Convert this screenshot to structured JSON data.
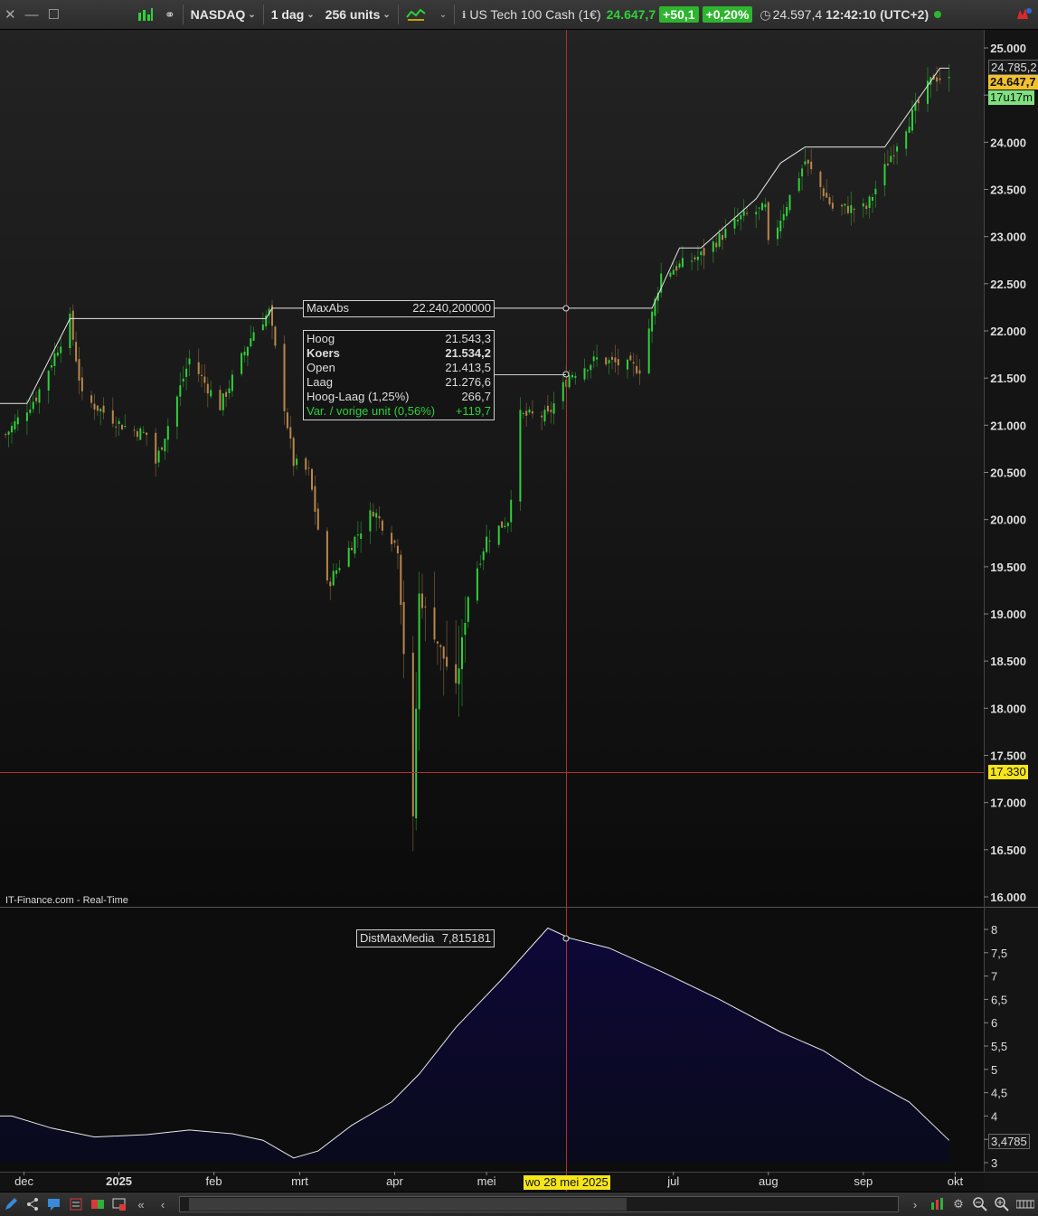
{
  "toolbar": {
    "market": "NASDAQ",
    "timeframe": "1 dag",
    "units": "256 units",
    "instrument": "US Tech 100 Cash (1€)",
    "price": "24.647,7",
    "change": "+50,1",
    "change_pct": "+0,20%",
    "prev_value": "24.597,4",
    "time": "12:42:10 (UTC+2)"
  },
  "legend_top": {
    "koers": "Koers",
    "maxabs": "MaxAbs"
  },
  "legend_bottom": {
    "label": "DistMaxMedia"
  },
  "source_label": "IT-Finance.com - Real-Time",
  "crosshair": {
    "price_tag": "17.330",
    "date_tag": "wo 28 mei 2025"
  },
  "price_tags": {
    "max": "24.785,2",
    "last": "24.647,7",
    "countdown": "17u17m"
  },
  "maxabs_tag": {
    "name": "MaxAbs",
    "value": "22.240,200000"
  },
  "dist_tag": {
    "name": "DistMaxMedia",
    "value": "7,815181",
    "last": "3,4785"
  },
  "tooltip": [
    {
      "label": "Hoog",
      "value": "21.543,3",
      "style": "normal"
    },
    {
      "label": "Koers",
      "value": "21.534,2",
      "style": "bold"
    },
    {
      "label": "Open",
      "value": "21.413,5",
      "style": "normal"
    },
    {
      "label": "Laag",
      "value": "21.276,6",
      "style": "normal"
    },
    {
      "label": "Hoog-Laag (1,25%)",
      "value": "266,7",
      "style": "normal"
    },
    {
      "label": "Var. / vorige unit (0,56%)",
      "value": "+119,7",
      "style": "green"
    }
  ],
  "colors": {
    "up": "#2fd03a",
    "down": "#b8864a",
    "line": "#e8e8e8",
    "crosshair": "#b03030",
    "area": "#0c0a2e"
  },
  "chart_data": [
    {
      "type": "candlestick",
      "title": "US Tech 100 Cash (1€)",
      "xlabel": "",
      "ylabel": "",
      "x_ticks": [
        "dec",
        "2025",
        "feb",
        "mrt",
        "apr",
        "mei",
        "jul",
        "aug",
        "sep",
        "okt"
      ],
      "y_ticks": [
        "25.000",
        "24.500",
        "24.000",
        "23.500",
        "23.000",
        "22.500",
        "22.000",
        "21.500",
        "21.000",
        "20.500",
        "20.000",
        "19.500",
        "19.000",
        "18.500",
        "18.000",
        "17.500",
        "17.000",
        "16.500",
        "16.000"
      ],
      "ylim": [
        16000,
        25000
      ],
      "x_range": [
        "2024-11-27",
        "2025-10-05"
      ],
      "series": [
        {
          "name": "Koers",
          "style": "ohlc-bars",
          "path": [
            [
              "2024-11-25",
              20900
            ],
            [
              "2024-12-05",
              21300
            ],
            [
              "2024-12-16",
              22120
            ],
            [
              "2024-12-20",
              21300
            ],
            [
              "2025-01-02",
              21000
            ],
            [
              "2025-01-10",
              20900
            ],
            [
              "2025-01-13",
              20600
            ],
            [
              "2025-01-24",
              21700
            ],
            [
              "2025-02-03",
              21200
            ],
            [
              "2025-02-14",
              22000
            ],
            [
              "2025-02-19",
              22200
            ],
            [
              "2025-02-27",
              20600
            ],
            [
              "2025-03-04",
              20500
            ],
            [
              "2025-03-10",
              19300
            ],
            [
              "2025-03-19",
              19800
            ],
            [
              "2025-03-25",
              20100
            ],
            [
              "2025-04-02",
              19700
            ],
            [
              "2025-04-04",
              18600
            ],
            [
              "2025-04-07",
              16800
            ],
            [
              "2025-04-09",
              19200
            ],
            [
              "2025-04-21",
              18200
            ],
            [
              "2025-04-25",
              19200
            ],
            [
              "2025-05-01",
              19800
            ],
            [
              "2025-05-08",
              20000
            ],
            [
              "2025-05-12",
              21100
            ],
            [
              "2025-05-21",
              21100
            ],
            [
              "2025-05-28",
              21534
            ],
            [
              "2025-06-06",
              21700
            ],
            [
              "2025-06-20",
              21600
            ],
            [
              "2025-06-27",
              22600
            ],
            [
              "2025-07-10",
              22800
            ],
            [
              "2025-07-23",
              23200
            ],
            [
              "2025-07-31",
              23300
            ],
            [
              "2025-08-01",
              22900
            ],
            [
              "2025-08-13",
              23800
            ],
            [
              "2025-08-22",
              23300
            ],
            [
              "2025-09-02",
              23300
            ],
            [
              "2025-09-12",
              24000
            ],
            [
              "2025-09-24",
              24700
            ],
            [
              "2025-09-29",
              24647.7
            ]
          ]
        },
        {
          "name": "MaxAbs",
          "style": "step-line",
          "steps": [
            [
              "2024-11-27",
              21230
            ],
            [
              "2024-12-02",
              21230
            ],
            [
              "2024-12-16",
              22130
            ],
            [
              "2025-02-18",
              22130
            ],
            [
              "2025-02-20",
              22240.2
            ],
            [
              "2025-06-24",
              22240.2
            ],
            [
              "2025-07-03",
              22880
            ],
            [
              "2025-07-10",
              22880
            ],
            [
              "2025-07-28",
              23400
            ],
            [
              "2025-08-05",
              23780
            ],
            [
              "2025-08-13",
              23950
            ],
            [
              "2025-09-08",
              23950
            ],
            [
              "2025-09-26",
              24785.2
            ],
            [
              "2025-09-29",
              24785.2
            ]
          ]
        }
      ]
    },
    {
      "type": "area",
      "title": "DistMaxMedia",
      "xlabel": "",
      "ylabel": "",
      "y_ticks": [
        "8",
        "7,5",
        "7",
        "6,5",
        "6",
        "5,5",
        "5",
        "4,5",
        "4",
        "3,5",
        "3"
      ],
      "ylim": [
        3,
        8
      ],
      "series": [
        {
          "name": "DistMaxMedia",
          "points": [
            [
              "2024-11-27",
              4.0
            ],
            [
              "2024-12-10",
              3.74
            ],
            [
              "2024-12-24",
              3.55
            ],
            [
              "2025-01-10",
              3.6
            ],
            [
              "2025-01-24",
              3.7
            ],
            [
              "2025-02-07",
              3.62
            ],
            [
              "2025-02-17",
              3.48
            ],
            [
              "2025-02-27",
              3.1
            ],
            [
              "2025-03-07",
              3.25
            ],
            [
              "2025-03-18",
              3.8
            ],
            [
              "2025-03-31",
              4.3
            ],
            [
              "2025-04-09",
              4.9
            ],
            [
              "2025-04-21",
              5.9
            ],
            [
              "2025-05-07",
              7.0
            ],
            [
              "2025-05-21",
              8.03
            ],
            [
              "2025-05-28",
              7.815
            ],
            [
              "2025-06-10",
              7.6
            ],
            [
              "2025-06-27",
              7.1
            ],
            [
              "2025-07-16",
              6.5
            ],
            [
              "2025-08-05",
              5.8
            ],
            [
              "2025-08-19",
              5.4
            ],
            [
              "2025-09-02",
              4.8
            ],
            [
              "2025-09-16",
              4.3
            ],
            [
              "2025-09-29",
              3.4785
            ]
          ]
        }
      ]
    }
  ]
}
